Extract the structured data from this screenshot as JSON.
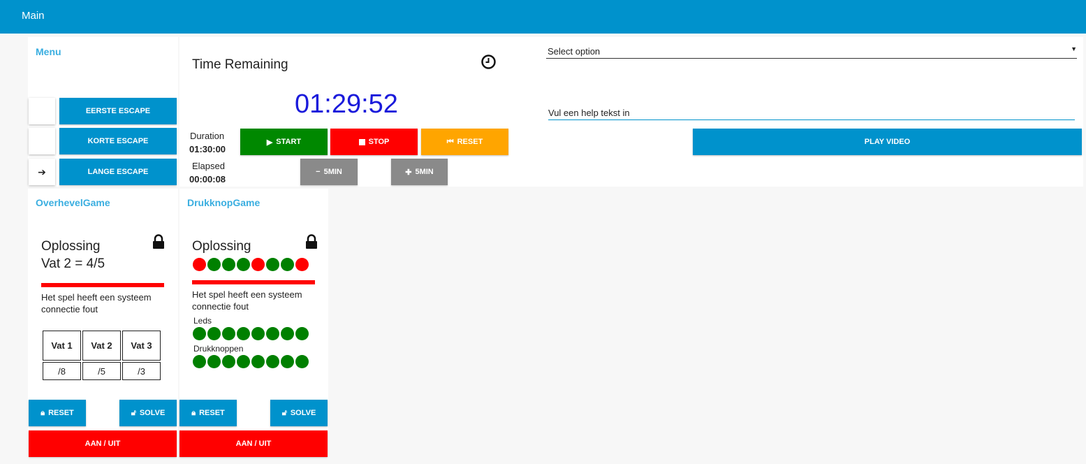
{
  "app": {
    "title": "Main"
  },
  "menu": {
    "title": "Menu",
    "items": [
      {
        "label": "EERSTE ESCAPE",
        "marker": ""
      },
      {
        "label": "KORTE ESCAPE",
        "marker": ""
      },
      {
        "label": "LANGE ESCAPE",
        "marker": "➔"
      }
    ]
  },
  "timer": {
    "heading": "Time Remaining",
    "clock_icon": "clock-icon",
    "remaining": "01:29:52",
    "duration_label": "Duration",
    "duration_value": "01:30:00",
    "elapsed_label": "Elapsed",
    "elapsed_value": "00:00:08",
    "start_label": "START",
    "stop_label": "STOP",
    "reset_label": "RESET",
    "minus_label": "5MIN",
    "plus_label": "5MIN"
  },
  "video": {
    "select_placeholder": "Select option",
    "help_placeholder": "Vul een help tekst in",
    "play_label": "PLAY VIDEO"
  },
  "games": [
    {
      "title": "OverhevelGame",
      "solution_label": "Oplossing",
      "solution_value": "Vat 2 = 4/5",
      "error_text": "Het spel heeft een systeem connectie fout",
      "table_headers": [
        "Vat 1",
        "Vat 2",
        "Vat 3"
      ],
      "table_values": [
        "/8",
        "/5",
        "/3"
      ],
      "reset_label": "RESET",
      "solve_label": "SOLVE",
      "power_label": "AAN / UIT"
    },
    {
      "title": "DrukknopGame",
      "solution_label": "Oplossing",
      "solution_dots": [
        "red",
        "green",
        "green",
        "green",
        "red",
        "green",
        "green",
        "red"
      ],
      "error_text": "Het spel heeft een systeem connectie fout",
      "leds_label": "Leds",
      "leds": [
        "green",
        "green",
        "green",
        "green",
        "green",
        "green",
        "green",
        "green"
      ],
      "buttons_label": "Drukknoppen",
      "buttons": [
        "green",
        "green",
        "green",
        "green",
        "green",
        "green",
        "green",
        "green"
      ],
      "reset_label": "RESET",
      "solve_label": "SOLVE",
      "power_label": "AAN / UIT"
    }
  ],
  "colors": {
    "primary": "#0092cc",
    "danger": "#ff0000",
    "success": "#008800",
    "warning": "#ffa500",
    "timer": "#1a1adb"
  }
}
